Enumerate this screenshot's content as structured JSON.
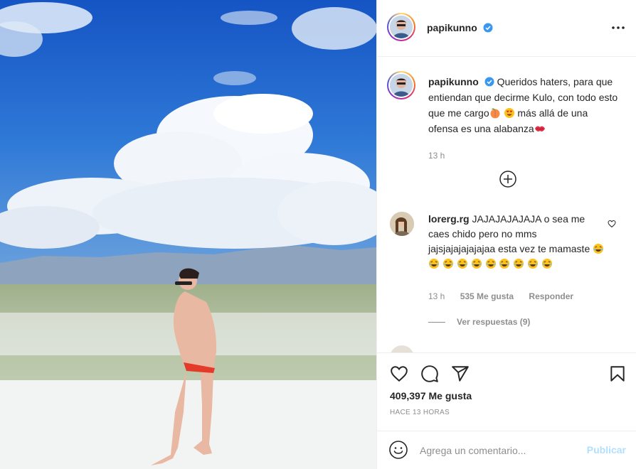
{
  "post": {
    "username": "papikunno",
    "verified": true,
    "caption": "Queridos haters, para que entiendan que decirme Kulo, con todo esto que me cargo🍑 😍 más allá de una ofensa es una alabanza💋",
    "caption_parts": {
      "a": "Queridos haters, para que entiendan que decirme Kulo, con todo esto que me cargo",
      "b": " más allá de una ofensa es una alabanza"
    },
    "caption_time": "13 h",
    "icons": {
      "verified": "verified-badge-icon",
      "more": "more-options-icon",
      "load_more": "load-more-comments-icon",
      "like": "heart-icon",
      "comment": "comment-icon",
      "share": "share-icon",
      "save": "bookmark-icon",
      "emoji": "emoji-icon"
    },
    "colors": {
      "verified": "#3897f0",
      "publish_disabled": "#b2dffc",
      "muted": "#8e8e8e"
    }
  },
  "comments": [
    {
      "username": "lorerg.rg",
      "text": "JAJAJAJAJAJA o sea me caes chido pero no mms jajsjajajajajajaa esta vez te mamaste",
      "emoji_count": 10,
      "time": "13 h",
      "likes": "535 Me gusta",
      "reply": "Responder",
      "view_replies": "Ver respuestas (9)"
    }
  ],
  "actions": {
    "likes": "409,397 Me gusta",
    "ago": "HACE 13 HORAS"
  },
  "add_comment": {
    "placeholder": "Agrega un comentario...",
    "publish": "Publicar"
  }
}
